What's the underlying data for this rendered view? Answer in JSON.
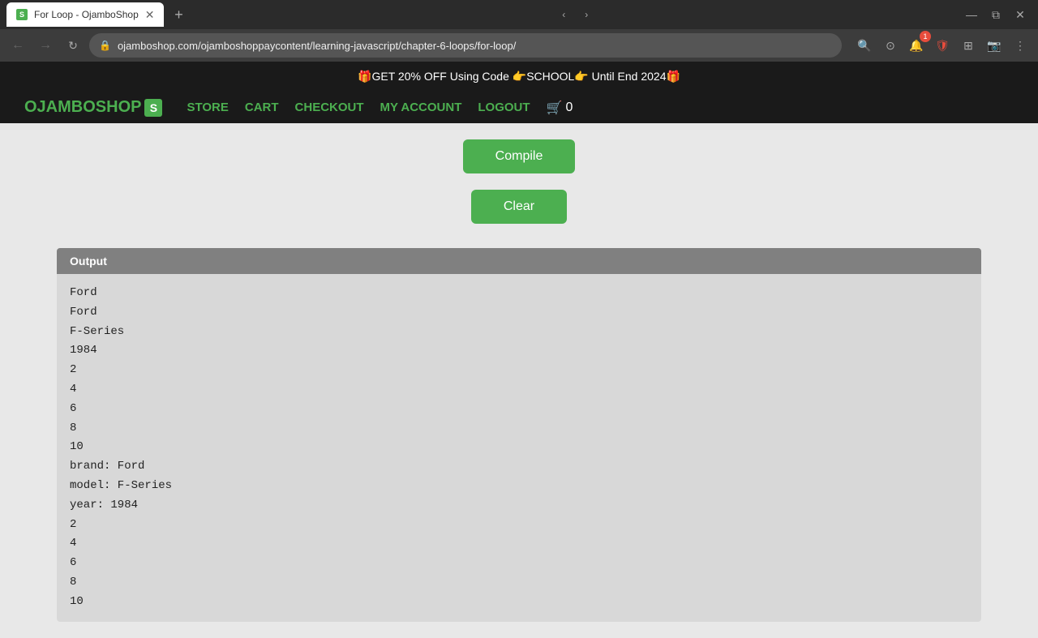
{
  "browser": {
    "tab_title": "For Loop - OjamboShop",
    "tab_favicon_letter": "S",
    "url": "ojamboshop.com/ojamboshoppaycontent/learning-javascript/chapter-6-loops/for-loop/",
    "new_tab_label": "+",
    "nav": {
      "back_disabled": true,
      "forward_disabled": true
    }
  },
  "promo_bar": {
    "text": "🎁GET 20% OFF Using Code 👉SCHOOL👉 Until End 2024🎁"
  },
  "navbar": {
    "logo_text": "OJAMBOSHOP",
    "logo_s": "S",
    "links": [
      {
        "label": "STORE"
      },
      {
        "label": "CART"
      },
      {
        "label": "CHECKOUT"
      },
      {
        "label": "MY ACCOUNT"
      },
      {
        "label": "LOGOUT"
      }
    ],
    "cart_icon": "🛒",
    "cart_count": "0"
  },
  "buttons": {
    "compile": "Compile",
    "clear": "Clear"
  },
  "output": {
    "header": "Output",
    "lines": [
      "Ford",
      "Ford",
      "F-Series",
      "1984",
      "2",
      "4",
      "6",
      "8",
      "10",
      "brand: Ford",
      "model: F-Series",
      "year: 1984",
      "2",
      "4",
      "6",
      "8",
      "10"
    ]
  }
}
